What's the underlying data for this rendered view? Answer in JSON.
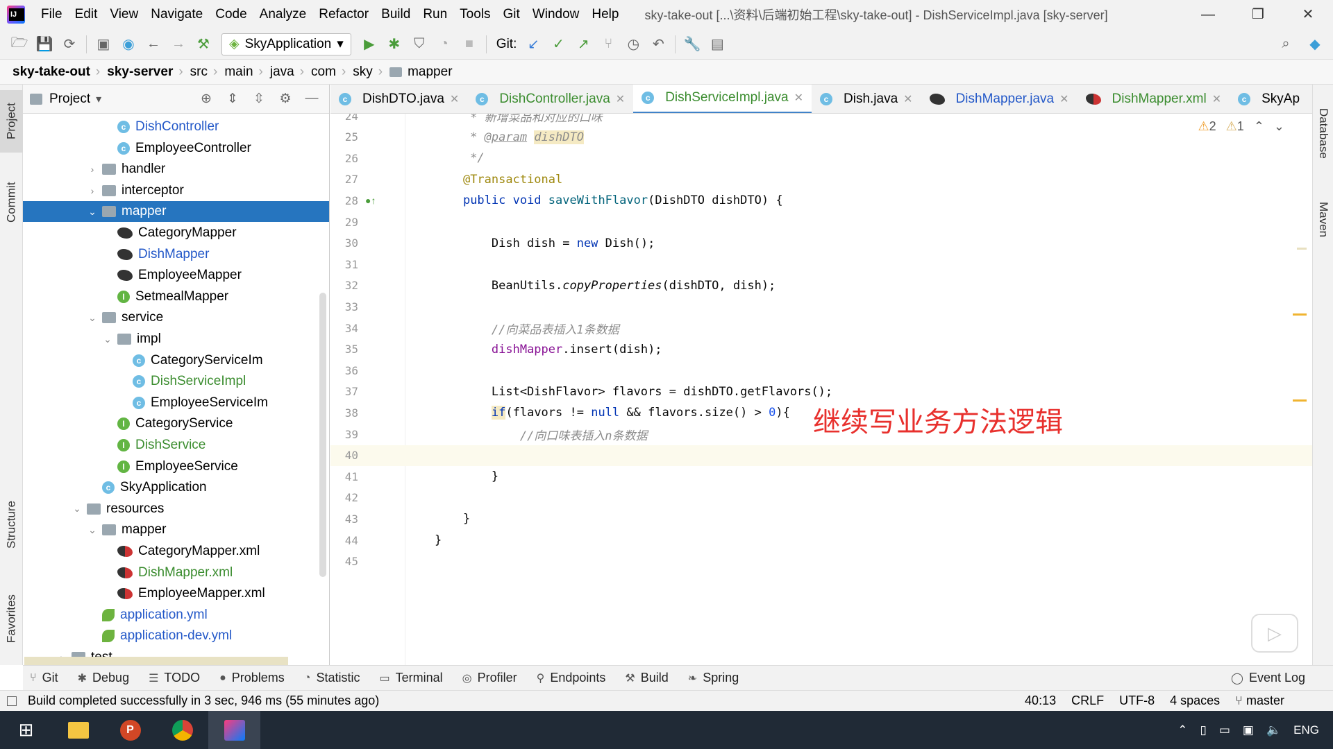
{
  "menubar": {
    "items": [
      "File",
      "Edit",
      "View",
      "Navigate",
      "Code",
      "Analyze",
      "Refactor",
      "Build",
      "Run",
      "Tools",
      "Git",
      "Window",
      "Help"
    ],
    "title": "sky-take-out [...\\资料\\后端初始工程\\sky-take-out] - DishServiceImpl.java [sky-server]"
  },
  "toolbar": {
    "run_config": "SkyApplication",
    "git_label": "Git:"
  },
  "breadcrumbs": [
    "sky-take-out",
    "sky-server",
    "src",
    "main",
    "java",
    "com",
    "sky",
    "mapper"
  ],
  "left_strip": {
    "project": "Project",
    "commit": "Commit",
    "structure": "Structure",
    "favorites": "Favorites"
  },
  "right_strip": {
    "database": "Database",
    "maven": "Maven"
  },
  "project_panel": {
    "title": "Project",
    "tree": [
      {
        "label": "DishController",
        "icon": "class",
        "indent": 3,
        "color": "blue"
      },
      {
        "label": "EmployeeController",
        "icon": "class",
        "indent": 3
      },
      {
        "label": "handler",
        "icon": "folder",
        "indent": 2,
        "arrow": "›"
      },
      {
        "label": "interceptor",
        "icon": "folder",
        "indent": 2,
        "arrow": "›"
      },
      {
        "label": "mapper",
        "icon": "folder",
        "indent": 2,
        "arrow": "⌄",
        "selected": true
      },
      {
        "label": "CategoryMapper",
        "icon": "mybatis",
        "indent": 3
      },
      {
        "label": "DishMapper",
        "icon": "mybatis",
        "indent": 3,
        "color": "blue"
      },
      {
        "label": "EmployeeMapper",
        "icon": "mybatis",
        "indent": 3
      },
      {
        "label": "SetmealMapper",
        "icon": "interface",
        "indent": 3
      },
      {
        "label": "service",
        "icon": "folder",
        "indent": 2,
        "arrow": "⌄"
      },
      {
        "label": "impl",
        "icon": "folder",
        "indent": 3,
        "arrow": "⌄"
      },
      {
        "label": "CategoryServiceIm",
        "icon": "class",
        "indent": 4
      },
      {
        "label": "DishServiceImpl",
        "icon": "class",
        "indent": 4,
        "color": "green"
      },
      {
        "label": "EmployeeServiceIm",
        "icon": "class",
        "indent": 4
      },
      {
        "label": "CategoryService",
        "icon": "interface",
        "indent": 3
      },
      {
        "label": "DishService",
        "icon": "interface",
        "indent": 3,
        "color": "green"
      },
      {
        "label": "EmployeeService",
        "icon": "interface",
        "indent": 3
      },
      {
        "label": "SkyApplication",
        "icon": "class",
        "indent": 2
      },
      {
        "label": "resources",
        "icon": "folder",
        "indent": 1,
        "arrow": "⌄"
      },
      {
        "label": "mapper",
        "icon": "folder",
        "indent": 2,
        "arrow": "⌄"
      },
      {
        "label": "CategoryMapper.xml",
        "icon": "mybatis-xml",
        "indent": 3
      },
      {
        "label": "DishMapper.xml",
        "icon": "mybatis-xml",
        "indent": 3,
        "color": "green"
      },
      {
        "label": "EmployeeMapper.xml",
        "icon": "mybatis-xml",
        "indent": 3
      },
      {
        "label": "application.yml",
        "icon": "spring",
        "indent": 2,
        "color": "blue"
      },
      {
        "label": "application-dev.yml",
        "icon": "spring",
        "indent": 2,
        "color": "blue"
      },
      {
        "label": "test",
        "icon": "folder",
        "indent": 0,
        "arrow": "›"
      }
    ]
  },
  "tabs": [
    {
      "label": "DishDTO.java",
      "icon": "class"
    },
    {
      "label": "DishController.java",
      "icon": "class",
      "color": "green"
    },
    {
      "label": "DishServiceImpl.java",
      "icon": "class",
      "color": "green",
      "active": true
    },
    {
      "label": "Dish.java",
      "icon": "class"
    },
    {
      "label": "DishMapper.java",
      "icon": "mybatis",
      "color": "blue"
    },
    {
      "label": "DishMapper.xml",
      "icon": "mybatis-xml",
      "color": "green"
    },
    {
      "label": "SkyAp",
      "icon": "class"
    }
  ],
  "editor": {
    "inspections": {
      "warnings": "2",
      "weak_warnings": "1"
    },
    "current_line": 40,
    "lines": [
      {
        "n": "24",
        "html": "<span class='cmt'>     * 新增菜品和对应的口味</span>"
      },
      {
        "n": "25",
        "html": "<span class='cmt'>     * <u>@param</u> </span><span class='cmt tag-hl'>dishDTO</span>"
      },
      {
        "n": "26",
        "html": "<span class='cmt'>     */</span>"
      },
      {
        "n": "27",
        "html": "    <span class='ann'>@Transactional</span>"
      },
      {
        "n": "28",
        "html": "    <span class='kw'>public void</span> <span class='fn'>saveWithFlavor</span>(DishDTO dishDTO) {"
      },
      {
        "n": "29",
        "html": ""
      },
      {
        "n": "30",
        "html": "        Dish dish = <span class='kw'>new</span> Dish();"
      },
      {
        "n": "31",
        "html": ""
      },
      {
        "n": "32",
        "html": "        BeanUtils.<span class='static-call'>copyProperties</span>(dishDTO, dish);"
      },
      {
        "n": "33",
        "html": ""
      },
      {
        "n": "34",
        "html": "        <span class='cmt'>//向菜品表插入1条数据</span>"
      },
      {
        "n": "35",
        "html": "        <span class='fld'>dishMapper</span>.insert(dish);"
      },
      {
        "n": "36",
        "html": ""
      },
      {
        "n": "37",
        "html": "        List&lt;DishFlavor&gt; flavors = dishDTO.getFlavors();"
      },
      {
        "n": "38",
        "html": "        <span class='kw tag-hl'>if</span>(flavors != <span class='kw'>null</span> &amp;&amp; flavors.size() &gt; <span class='num'>0</span>){"
      },
      {
        "n": "39",
        "html": "            <span class='cmt'>//向口味表插入n条数据</span>"
      },
      {
        "n": "40",
        "html": ""
      },
      {
        "n": "41",
        "html": "        }"
      },
      {
        "n": "42",
        "html": ""
      },
      {
        "n": "43",
        "html": "    }"
      },
      {
        "n": "44",
        "html": "}"
      },
      {
        "n": "45",
        "html": ""
      }
    ],
    "overlay_note": "继续写业务方法逻辑"
  },
  "tool_tabs": [
    {
      "label": "Git",
      "icon": "⑂"
    },
    {
      "label": "Debug",
      "icon": "✱"
    },
    {
      "label": "TODO",
      "icon": "☰"
    },
    {
      "label": "Problems",
      "icon": "●"
    },
    {
      "label": "Statistic",
      "icon": "◔"
    },
    {
      "label": "Terminal",
      "icon": "▭"
    },
    {
      "label": "Profiler",
      "icon": "◎"
    },
    {
      "label": "Endpoints",
      "icon": "⚲"
    },
    {
      "label": "Build",
      "icon": "⚒"
    },
    {
      "label": "Spring",
      "icon": "❧"
    }
  ],
  "event_log": "Event Log",
  "status": {
    "message": "Build completed successfully in 3 sec, 946 ms (55 minutes ago)",
    "position": "40:13",
    "line_sep": "CRLF",
    "encoding": "UTF-8",
    "indent": "4 spaces",
    "branch": "master"
  },
  "taskbar": {
    "lang": "ENG"
  },
  "colors": {
    "selection": "#2675bf",
    "accent_tab": "#4083c9",
    "note": "#e8302d"
  }
}
